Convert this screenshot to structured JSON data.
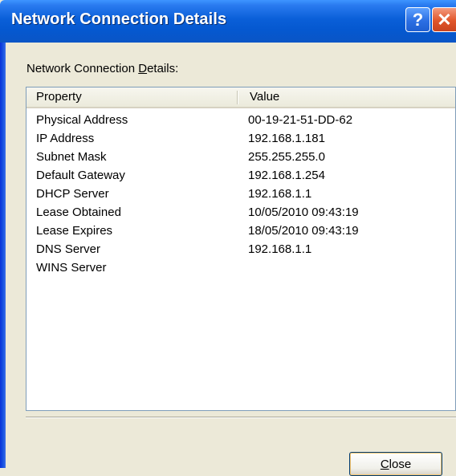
{
  "window": {
    "title": "Network Connection Details",
    "help_glyph": "?",
    "close_glyph": "✕"
  },
  "group": {
    "label_prefix": "Network Connection ",
    "label_accel": "D",
    "label_suffix": "etails:"
  },
  "list": {
    "columns": [
      "Property",
      "Value"
    ],
    "rows": [
      {
        "property": "Physical Address",
        "value": "00-19-21-51-DD-62"
      },
      {
        "property": "IP Address",
        "value": "192.168.1.181"
      },
      {
        "property": "Subnet Mask",
        "value": "255.255.255.0"
      },
      {
        "property": "Default Gateway",
        "value": "192.168.1.254"
      },
      {
        "property": "DHCP Server",
        "value": "192.168.1.1"
      },
      {
        "property": "Lease Obtained",
        "value": "10/05/2010 09:43:19"
      },
      {
        "property": "Lease Expires",
        "value": "18/05/2010 09:43:19"
      },
      {
        "property": "DNS Server",
        "value": "192.168.1.1"
      },
      {
        "property": "WINS Server",
        "value": ""
      }
    ]
  },
  "buttons": {
    "close_accel": "C",
    "close_rest": "lose"
  },
  "colors": {
    "title_bar": "#0558D0",
    "dialog_bg": "#ECE9D8",
    "close_red": "#E1552A"
  }
}
